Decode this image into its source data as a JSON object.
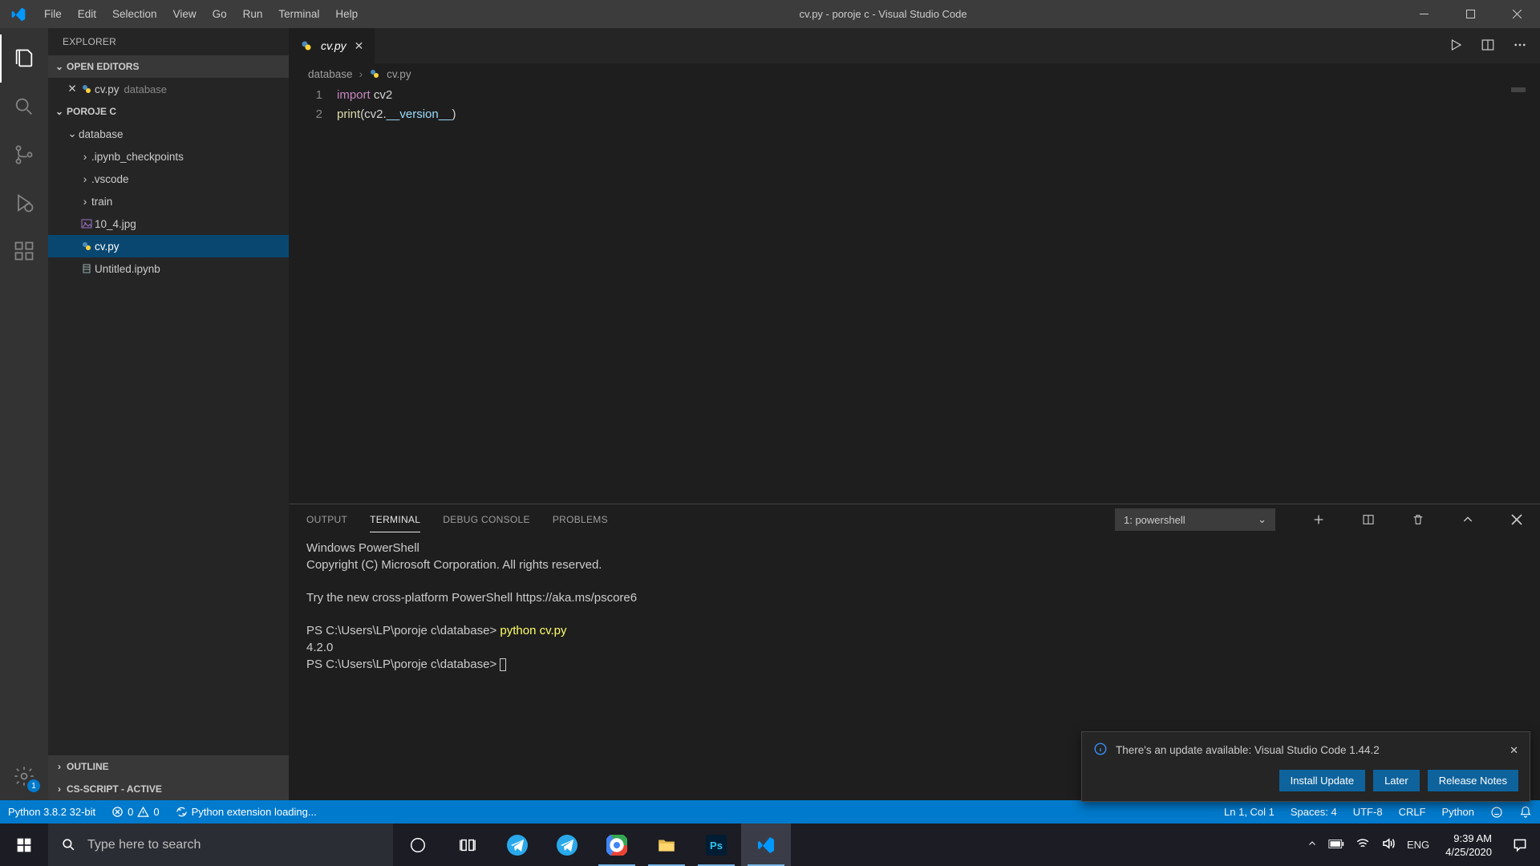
{
  "titlebar": {
    "title": "cv.py - poroje c - Visual Studio Code",
    "menus": [
      "File",
      "Edit",
      "Selection",
      "View",
      "Go",
      "Run",
      "Terminal",
      "Help"
    ]
  },
  "activitybar": {
    "settings_badge": "1"
  },
  "sidebar": {
    "title": "EXPLORER",
    "open_editors_hdr": "OPEN EDITORS",
    "open_editor": {
      "name": "cv.py",
      "sub": "database"
    },
    "project_hdr": "POROJE C",
    "tree": {
      "root": "database",
      "folders": [
        ".ipynb_checkpoints",
        ".vscode",
        "train"
      ],
      "files": [
        {
          "name": "10_4.jpg",
          "icon": "image"
        },
        {
          "name": "cv.py",
          "icon": "python",
          "selected": true
        },
        {
          "name": "Untitled.ipynb",
          "icon": "notebook"
        }
      ]
    },
    "outline_hdr": "OUTLINE",
    "csscript_hdr": "CS-SCRIPT - ACTIVE"
  },
  "editor": {
    "tab_name": "cv.py",
    "breadcrumbs": {
      "root": "database",
      "file": "cv.py"
    },
    "lines": [
      "1",
      "2"
    ],
    "code": {
      "l1_kw": "import",
      "l1_rest": " cv2",
      "l2_fn": "print",
      "l2_open": "(cv2.",
      "l2_var": "__version__",
      "l2_close": ")"
    }
  },
  "panel": {
    "tabs": [
      "OUTPUT",
      "TERMINAL",
      "DEBUG CONSOLE",
      "PROBLEMS"
    ],
    "term_selected": "1: powershell",
    "terminal": {
      "l1": "Windows PowerShell",
      "l2": "Copyright (C) Microsoft Corporation. All rights reserved.",
      "l3": "Try the new cross-platform PowerShell https://aka.ms/pscore6",
      "prompt1": "PS C:\\Users\\LP\\poroje c\\database> ",
      "cmd": "python cv.py",
      "output": "4.2.0",
      "prompt2": "PS C:\\Users\\LP\\poroje c\\database> "
    }
  },
  "notification": {
    "msg": "There's an update available: Visual Studio Code 1.44.2",
    "btns": [
      "Install Update",
      "Later",
      "Release Notes"
    ]
  },
  "statusbar": {
    "python": "Python 3.8.2 32-bit",
    "errors": "0",
    "warnings": "0",
    "loading": "Python extension loading...",
    "lncol": "Ln 1, Col 1",
    "spaces": "Spaces: 4",
    "encoding": "UTF-8",
    "eol": "CRLF",
    "lang": "Python"
  },
  "taskbar": {
    "search_placeholder": "Type here to search",
    "lang": "ENG",
    "time": "9:39 AM",
    "date": "4/25/2020"
  }
}
